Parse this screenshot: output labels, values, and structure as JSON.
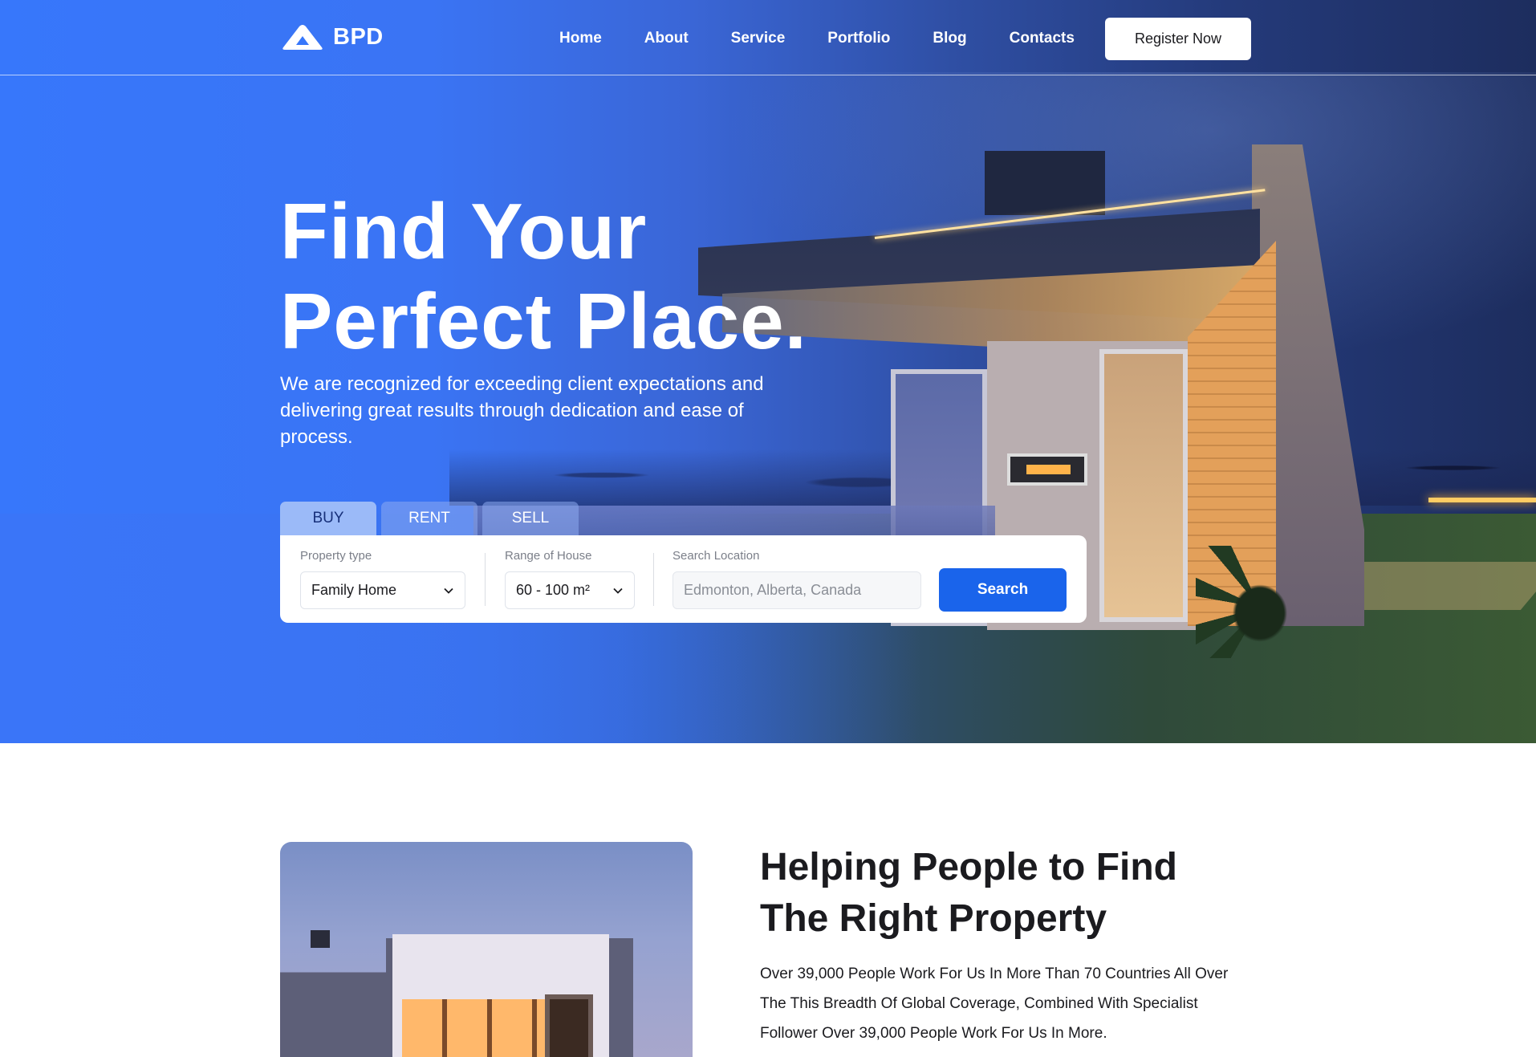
{
  "brand": {
    "name": "BPD",
    "accent": "#1a64eb",
    "hero_blue": "#3777fb"
  },
  "nav": {
    "items": [
      "Home",
      "About",
      "Service",
      "Portfolio",
      "Blog",
      "Contacts"
    ],
    "register_label": "Register Now"
  },
  "hero": {
    "title_line1": "Find Your",
    "title_line2": "Perfect Place.",
    "subtitle": "We are recognized for exceeding client expectations and delivering great results through dedication and ease of process."
  },
  "search": {
    "tabs": [
      "BUY",
      "RENT",
      "SELL"
    ],
    "active_tab": "BUY",
    "property_type_label": "Property type",
    "property_type_value": "Family Home",
    "range_label": "Range of House",
    "range_value": "60 - 100 m²",
    "location_label": "Search Location",
    "location_placeholder": "Edmonton, Alberta, Canada",
    "button_label": "Search"
  },
  "about": {
    "title_line1": "Helping People to Find",
    "title_line2": "The Right Property",
    "text": "Over 39,000 People Work For Us In More Than 70 Countries All Over The This Breadth Of Global Coverage, Combined With Specialist Follower Over 39,000 People Work For Us In More."
  },
  "icons": {
    "logo": "logo-triangle-icon",
    "dropdown": "chevron-down-icon"
  }
}
